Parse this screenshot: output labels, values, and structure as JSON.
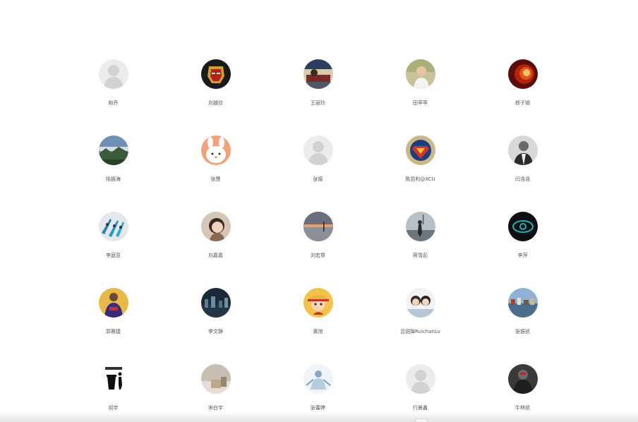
{
  "colors": {
    "page_background": "#ffffff",
    "name_text": "#555555",
    "default_avatar_bg": "#ececec",
    "default_avatar_figure": "#d4d4d4"
  },
  "users": [
    {
      "name": "和乔",
      "avatar": "default-person-icon"
    },
    {
      "name": "刘雄欣",
      "avatar": "iron-man-avatar"
    },
    {
      "name": "王丽玲",
      "avatar": "illustration-avatar"
    },
    {
      "name": "田苹苹",
      "avatar": "portrait-avatar"
    },
    {
      "name": "郎子锡",
      "avatar": "flame-avatar"
    },
    {
      "name": "陆振海",
      "avatar": "landscape-avatar"
    },
    {
      "name": "张慧",
      "avatar": "cartoon-bunny-avatar"
    },
    {
      "name": "张振",
      "avatar": "default-person-icon"
    },
    {
      "name": "陈昱利@XCU",
      "avatar": "superman-logo-avatar"
    },
    {
      "name": "闫浩浩",
      "avatar": "bw-portrait-avatar"
    },
    {
      "name": "李庭亚",
      "avatar": "boats-avatar"
    },
    {
      "name": "刘嘉嘉",
      "avatar": "girl-portrait-avatar"
    },
    {
      "name": "刘宏章",
      "avatar": "sunset-lake-avatar"
    },
    {
      "name": "蒋雪彭",
      "avatar": "hiker-avatar"
    },
    {
      "name": "李萍",
      "avatar": "eye-logo-avatar"
    },
    {
      "name": "郭赛捷",
      "avatar": "basketball-player-avatar"
    },
    {
      "name": "李文静",
      "avatar": "night-city-avatar"
    },
    {
      "name": "黄旭",
      "avatar": "anime-character-avatar"
    },
    {
      "name": "吕锐婵RuichanLv",
      "avatar": "family-photo-avatar"
    },
    {
      "name": "张振凯",
      "avatar": "harbor-avatar"
    },
    {
      "name": "闵宇",
      "avatar": "trash-sign-avatar"
    },
    {
      "name": "宋白宇",
      "avatar": "room-photo-avatar"
    },
    {
      "name": "张蕾婷",
      "avatar": "winter-figure-avatar"
    },
    {
      "name": "行晨鑫",
      "avatar": "default-person-icon"
    },
    {
      "name": "牛林凯",
      "avatar": "hero-portrait-avatar"
    }
  ]
}
